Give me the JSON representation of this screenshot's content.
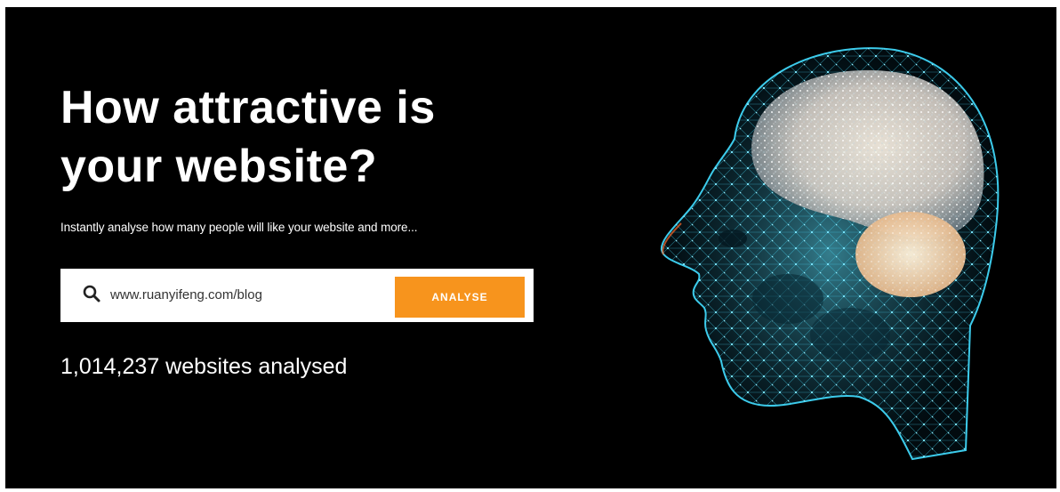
{
  "hero": {
    "headline_line1": "How attractive is",
    "headline_line2": "your website?",
    "subtitle": "Instantly analyse how many people will like your website and more..."
  },
  "search": {
    "value": "www.ruanyifeng.com/blog",
    "icon": "search-icon",
    "button_label": "ANALYSE"
  },
  "stats": {
    "count_text": "1,014,237 websites analysed"
  },
  "colors": {
    "background": "#000000",
    "accent": "#f7941d",
    "head_wireframe": "#2fc6e6",
    "brain": "#f3e6d6"
  }
}
